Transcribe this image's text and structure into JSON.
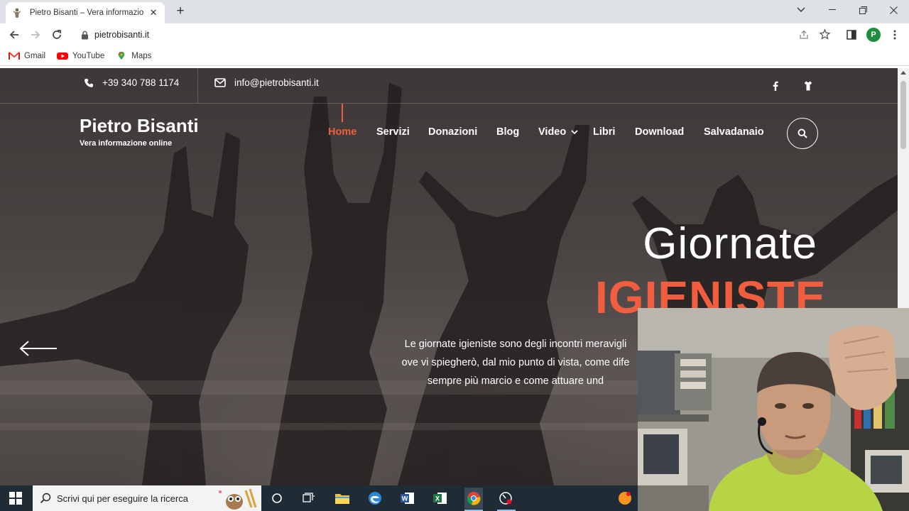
{
  "browser": {
    "tab_title": "Pietro Bisanti – Vera informazione online",
    "new_tab_label": "+",
    "url": "pietrobisanti.it",
    "profile_initial": "P",
    "bookmarks": [
      {
        "label": "Gmail"
      },
      {
        "label": "YouTube"
      },
      {
        "label": "Maps"
      }
    ]
  },
  "site": {
    "phone": "+39 340 788 1174",
    "email": "info@pietrobisanti.it",
    "brand_name": "Pietro Bisanti",
    "brand_tagline": "Vera informazione online",
    "menu": [
      {
        "label": "Home",
        "active": true
      },
      {
        "label": "Servizi"
      },
      {
        "label": "Donazioni"
      },
      {
        "label": "Blog"
      },
      {
        "label": "Video",
        "has_dropdown": true
      },
      {
        "label": "Libri"
      },
      {
        "label": "Download"
      },
      {
        "label": "Salvadanaio"
      }
    ],
    "hero": {
      "title_line1": "Giornate",
      "title_line2": "IGIENISTE",
      "text_lines": [
        "Le giornate igieniste sono degli incontri meravigli",
        "ove vi spiegherò, dal mio punto di vista, come dife",
        "sempre più marcio e come attuare und"
      ]
    },
    "accent_color": "#f15d3f"
  },
  "taskbar": {
    "search_placeholder": "Scrivi qui per eseguire la ricerca"
  }
}
